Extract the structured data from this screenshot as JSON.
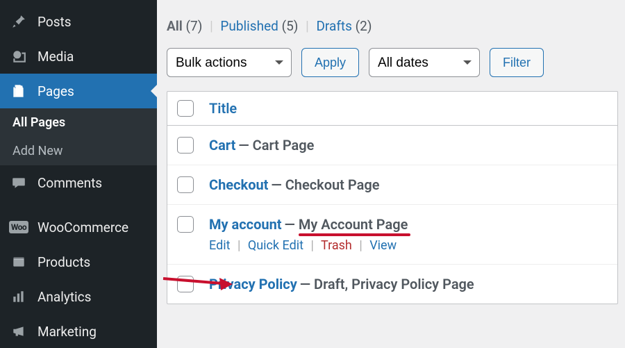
{
  "sidebar": {
    "items": [
      {
        "name": "posts",
        "label": "Posts"
      },
      {
        "name": "media",
        "label": "Media"
      },
      {
        "name": "pages",
        "label": "Pages"
      },
      {
        "name": "comments",
        "label": "Comments"
      },
      {
        "name": "woocommerce",
        "label": "WooCommerce"
      },
      {
        "name": "products",
        "label": "Products"
      },
      {
        "name": "analytics",
        "label": "Analytics"
      },
      {
        "name": "marketing",
        "label": "Marketing"
      }
    ],
    "pages_submenu": {
      "all": "All Pages",
      "add": "Add New"
    }
  },
  "filters": {
    "all_label": "All",
    "all_count": "(7)",
    "published_label": "Published",
    "published_count": "(5)",
    "drafts_label": "Drafts",
    "drafts_count": "(2)"
  },
  "actions": {
    "bulk_selected": "Bulk actions",
    "apply": "Apply",
    "date_selected": "All dates",
    "filter": "Filter"
  },
  "table": {
    "title_col": "Title",
    "rows": [
      {
        "title": "Cart",
        "desc": "Cart Page"
      },
      {
        "title": "Checkout",
        "desc": "Checkout Page"
      },
      {
        "title": "My account",
        "desc": "My Account Page",
        "hover": true
      },
      {
        "title": "Privacy Policy",
        "desc": "Draft, Privacy Policy Page"
      }
    ],
    "dash": " — ",
    "row_actions": {
      "edit": "Edit",
      "quick_edit": "Quick Edit",
      "trash": "Trash",
      "view": "View"
    }
  }
}
